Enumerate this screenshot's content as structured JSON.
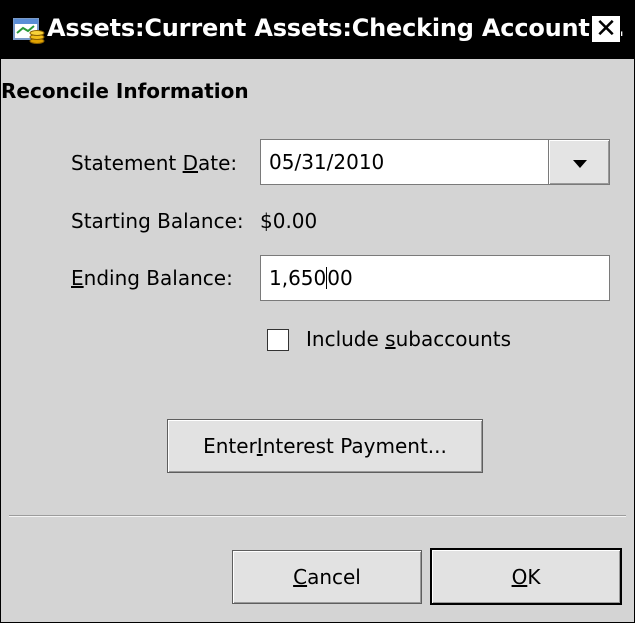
{
  "window": {
    "title": "Assets:Current Assets:Checking Account ...",
    "close_icon": "close-icon",
    "app_icon": "gnucash-app-icon"
  },
  "section": {
    "title": "Reconcile Information"
  },
  "statement_date": {
    "label_pre": "Statement ",
    "label_ul": "D",
    "label_post": "ate:",
    "value": "05/31/2010"
  },
  "starting_balance": {
    "label": "Starting Balance:",
    "value": "$0.00"
  },
  "ending_balance": {
    "label_ul": "E",
    "label_post": "nding Balance:",
    "value_before_caret": "1,650",
    "value_after_caret": "00"
  },
  "include_subaccounts": {
    "label_pre": "Include ",
    "label_ul": "s",
    "label_post": "ubaccounts",
    "checked": false
  },
  "interest_button": {
    "label_pre": "Enter ",
    "label_ul": "I",
    "label_post": "nterest Payment..."
  },
  "buttons": {
    "cancel_ul": "C",
    "cancel_post": "ancel",
    "ok_ul": "O",
    "ok_post": "K"
  }
}
